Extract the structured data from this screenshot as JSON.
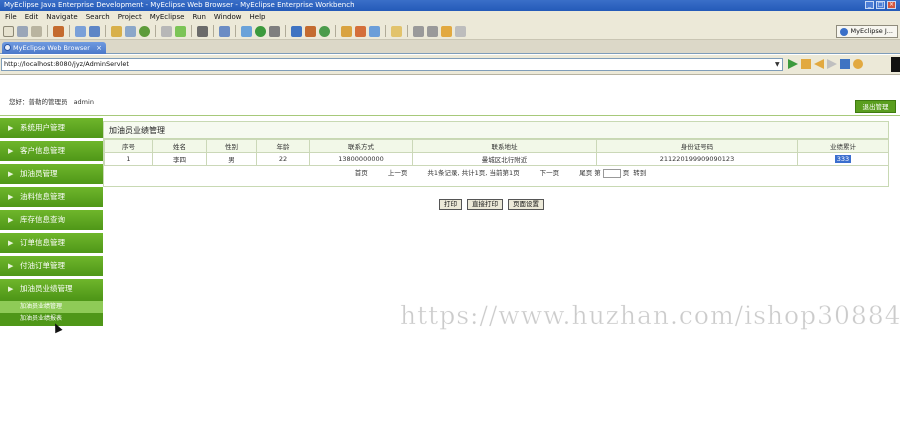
{
  "window": {
    "title": "MyEclipse Java Enterprise Development - MyEclipse Web Browser - MyEclipse Enterprise Workbench"
  },
  "menubar": [
    "File",
    "Edit",
    "Navigate",
    "Search",
    "Project",
    "MyEclipse",
    "Run",
    "Window",
    "Help"
  ],
  "perspective": {
    "label": "MyEclipse J..."
  },
  "tab": {
    "label": "MyEclipse Web Browser"
  },
  "address": {
    "url": "http://localhost:8080/jyz/AdminServlet"
  },
  "header": {
    "welcome": "您好：普勒的管理员",
    "user": "admin",
    "logout_label": "退出管理"
  },
  "sidebar": {
    "items": [
      {
        "label": "系统用户管理"
      },
      {
        "label": "客户信息管理"
      },
      {
        "label": "加油员管理"
      },
      {
        "label": "油料信息管理"
      },
      {
        "label": "库存信息查询"
      },
      {
        "label": "订单信息管理"
      },
      {
        "label": "付油订单管理"
      },
      {
        "label": "加油员业绩管理"
      }
    ],
    "subitems": [
      {
        "label": "加油员业绩管理"
      },
      {
        "label": "加油员业绩报表"
      }
    ]
  },
  "main": {
    "title": "加油员业绩管理",
    "columns": [
      "序号",
      "姓名",
      "性别",
      "年龄",
      "联系方式",
      "联系地址",
      "身份证号码",
      "业绩累计"
    ],
    "rows": [
      [
        "1",
        "李四",
        "男",
        "22",
        "13800000000",
        "曼城区北行附近",
        "211220199909090123",
        "333"
      ]
    ],
    "pager": {
      "first": "首页",
      "prev": "上一页",
      "summary": "共1条记录, 共计1页, 当前第1页",
      "next": "下一页",
      "last": "尾页",
      "page_prefix": "第",
      "page_suffix": "页",
      "goto": "转到"
    }
  },
  "print_buttons": {
    "print": "打印",
    "direct_print": "直接打印",
    "page_setup": "页面设置"
  },
  "watermark": "https://www.huzhan.com/ishop30884",
  "colors": {
    "sidebar_green": "#5aa420",
    "title_blue": "#245ab8",
    "selection_blue": "#3b6fce"
  }
}
